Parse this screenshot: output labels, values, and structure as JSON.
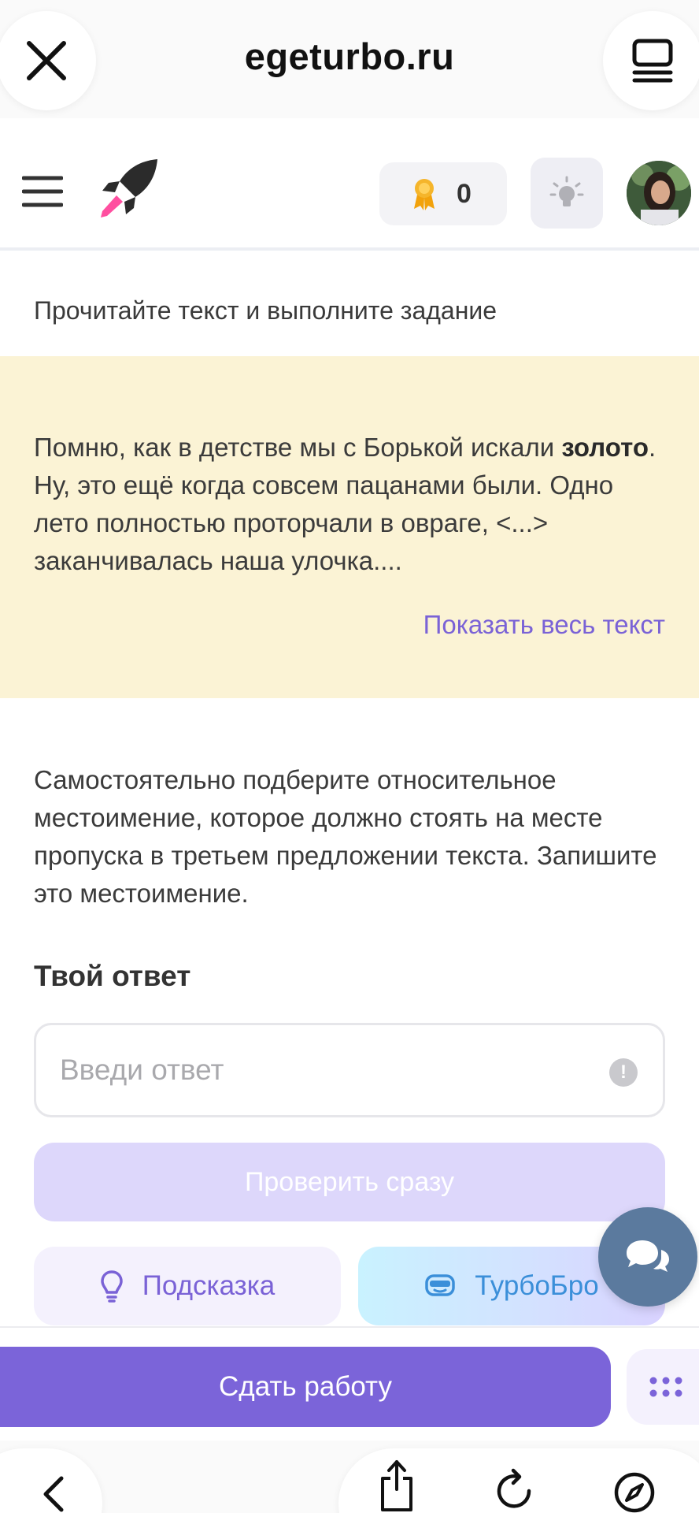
{
  "browser": {
    "url": "egeturbo.ru",
    "close_icon": "close-icon",
    "tabs_icon": "tabs-icon",
    "bottom_icons": [
      "back-icon",
      "share-icon",
      "reload-icon",
      "compass-icon"
    ]
  },
  "header": {
    "menu_icon": "menu-icon",
    "logo_icon": "rocket-icon",
    "awards_count": "0",
    "theme_icon": "lightbulb-icon"
  },
  "content": {
    "instruction": "Прочитайте текст и выполните задание",
    "excerpt_before": "Помню, как в детстве мы с Борькой искали ",
    "excerpt_bold": "золото",
    "excerpt_after": ". Ну, это ещё когда совсем пацанами были. Одно лето полностью проторчали в овраге, <...> заканчивалась наша улочка....",
    "show_all": "Показать весь текст",
    "task": "Самостоятельно подберите относительное местоимение, которое должно стоять на месте пропуска в третьем предложении текста. Запишите это местоимение.",
    "answer_label": "Твой ответ",
    "answer_placeholder": "Введи ответ",
    "answer_value": "",
    "info_glyph": "!",
    "check_button": "Проверить сразу",
    "hint_button": "Подсказка",
    "turbo_button": "ТурбоБро",
    "submit_button": "Сдать работу"
  },
  "colors": {
    "accent": "#7b64d9",
    "card_bg": "#fbf3d5",
    "link": "#7a62d6",
    "turbo_text": "#3b8fd9",
    "chat_fab": "#5b7a9e"
  }
}
